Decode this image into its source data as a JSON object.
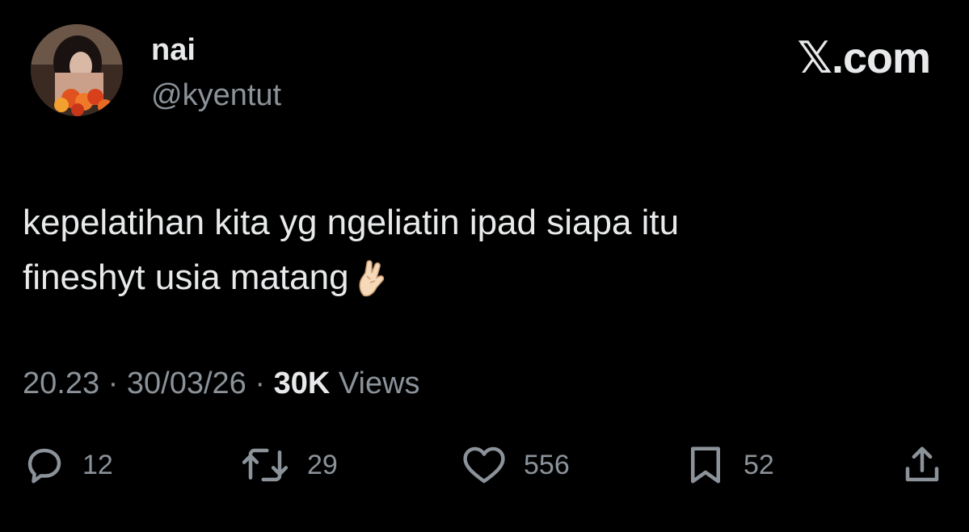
{
  "user": {
    "display_name": "nai",
    "handle": "@kyentut",
    "avatar_icon": "profile-photo"
  },
  "brand": "𝕏.com",
  "tweet": {
    "lines": [
      "kepelatihan kita yg ngeliatin ipad siapa itu",
      "fineshyt usia matang"
    ],
    "emoji_icon": "crossed-fingers-emoji"
  },
  "meta": {
    "time": "20.23",
    "separator": "·",
    "date": "30/03/26",
    "views_count": "30K",
    "views_label": "Views"
  },
  "actions": {
    "replies": "12",
    "reposts": "29",
    "likes": "556",
    "bookmarks": "52"
  },
  "colors": {
    "background": "#000000",
    "primary_text": "#e7e9ea",
    "secondary_text": "#8b9299"
  }
}
